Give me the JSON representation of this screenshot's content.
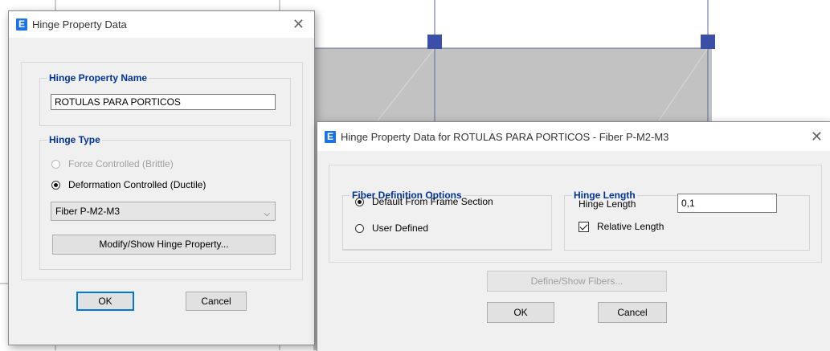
{
  "dialog1": {
    "title": "Hinge Property Data",
    "hinge_property_name": {
      "legend": "Hinge Property Name",
      "value": "ROTULAS PARA PORTICOS"
    },
    "hinge_type": {
      "legend": "Hinge Type",
      "option_force": "Force Controlled  (Brittle)",
      "option_deformation": "Deformation Controlled  (Ductile)",
      "selected": "Deformation Controlled  (Ductile)",
      "combo_value": "Fiber P-M2-M3",
      "modify_button": "Modify/Show Hinge Property..."
    },
    "ok_label": "OK",
    "cancel_label": "Cancel"
  },
  "dialog2": {
    "title": "Hinge Property Data for ROTULAS PARA PORTICOS - Fiber P-M2-M3",
    "fiber_definition": {
      "legend": "Fiber Definition Options",
      "option_default": "Default From Frame Section",
      "option_user": "User Defined",
      "selected": "Default From Frame Section"
    },
    "hinge_length": {
      "legend": "Hinge Length",
      "label": "Hinge Length",
      "value": "0,1",
      "relative_label": "Relative Length",
      "relative_checked": true
    },
    "define_fibers_button": "Define/Show Fibers...",
    "ok_label": "OK",
    "cancel_label": "Cancel"
  },
  "app_icon_letter": "E",
  "colors": {
    "accent": "#1a73e8",
    "legend_blue": "#003399",
    "frame_fill": "#c2c2c2",
    "node_blue": "#3b4fa8"
  }
}
